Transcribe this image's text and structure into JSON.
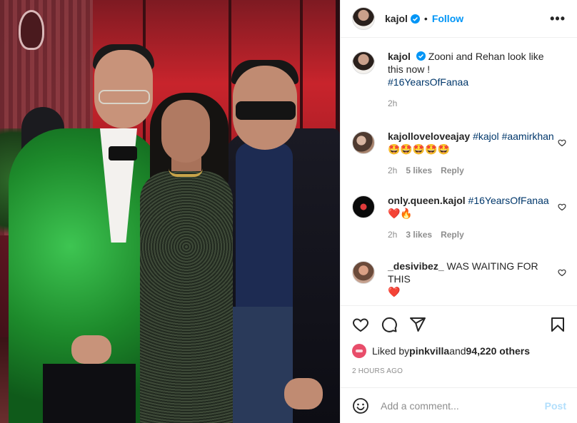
{
  "header": {
    "username": "kajol",
    "follow_label": "Follow",
    "more_label": "•••",
    "verified_icon": "verified-badge-icon"
  },
  "caption": {
    "username": "kajol",
    "text": "Zooni and Rehan look like this now !",
    "hashtag": "#16YearsOfFanaa",
    "time": "2h"
  },
  "comments": [
    {
      "username": "kajolloveloveajay",
      "tag1": "#kajol",
      "tag2": "#aamirkhan",
      "emoji": "🤩🤩🤩🤩🤩",
      "time": "2h",
      "likes": "5 likes",
      "reply": "Reply"
    },
    {
      "username": "only.queen.kajol",
      "tag1": "#16YearsOfFanaa",
      "emoji": "❤️🔥",
      "time": "2h",
      "likes": "3 likes",
      "reply": "Reply"
    },
    {
      "username": "_desivibez_",
      "text": "WAS WAITING FOR THIS",
      "emoji": "❤️"
    }
  ],
  "likes": {
    "prefix": "Liked by ",
    "user": "pinkvilla",
    "middle": " and ",
    "count": "94,220 others"
  },
  "timestamp": "2 HOURS AGO",
  "add_comment": {
    "placeholder": "Add a comment...",
    "post_label": "Post"
  },
  "colors": {
    "link": "#0095f6",
    "hashtag": "#00376b",
    "meta": "#8e8e8e",
    "post_disabled": "#b2dffc"
  },
  "icons": [
    "heart-icon",
    "comment-icon",
    "share-icon",
    "bookmark-icon",
    "emoji-icon",
    "more-icon"
  ]
}
